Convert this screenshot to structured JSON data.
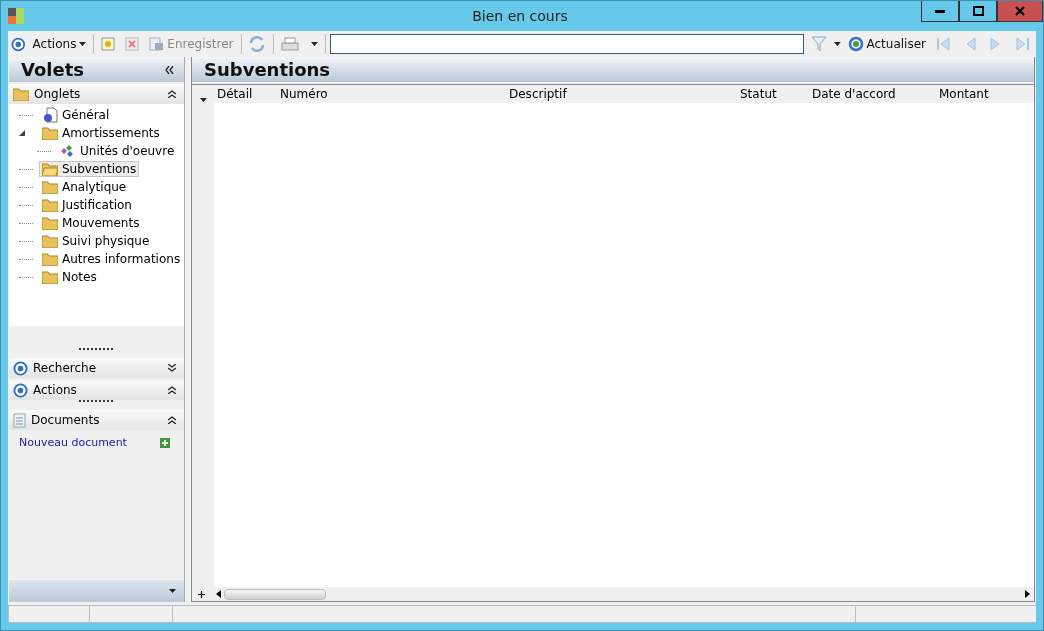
{
  "window": {
    "title": "Bien en cours"
  },
  "toolbar": {
    "actions_menu": "Actions",
    "save": "Enregistrer",
    "refresh": "Actualiser"
  },
  "side_panel": {
    "title": "Volets",
    "tabs_section": {
      "title": "Onglets",
      "expanded": true,
      "tree": [
        {
          "label": "Général",
          "kind": "page",
          "selected": false
        },
        {
          "label": "Amortissements",
          "kind": "folder",
          "selected": false,
          "expanded": true,
          "children": [
            {
              "label": "Unités d'oeuvre",
              "kind": "item",
              "selected": false
            }
          ]
        },
        {
          "label": "Subventions",
          "kind": "folder",
          "selected": true
        },
        {
          "label": "Analytique",
          "kind": "folder",
          "selected": false
        },
        {
          "label": "Justification",
          "kind": "folder",
          "selected": false
        },
        {
          "label": "Mouvements",
          "kind": "folder",
          "selected": false
        },
        {
          "label": "Suivi physique",
          "kind": "folder",
          "selected": false
        },
        {
          "label": "Autres informations",
          "kind": "folder",
          "selected": false
        },
        {
          "label": "Notes",
          "kind": "folder",
          "selected": false
        }
      ]
    },
    "sections": [
      {
        "title": "Recherche",
        "kind": "target",
        "expanded": false
      },
      {
        "title": "Actions",
        "kind": "target",
        "expanded": true
      }
    ],
    "documents": {
      "title": "Documents",
      "expanded": true,
      "link": "Nouveau document"
    }
  },
  "main": {
    "title": "Subventions",
    "table": {
      "columns": [
        "Détail",
        "Numéro",
        "Descriptif",
        "Statut",
        "Date d'accord",
        "Montant"
      ]
    }
  }
}
